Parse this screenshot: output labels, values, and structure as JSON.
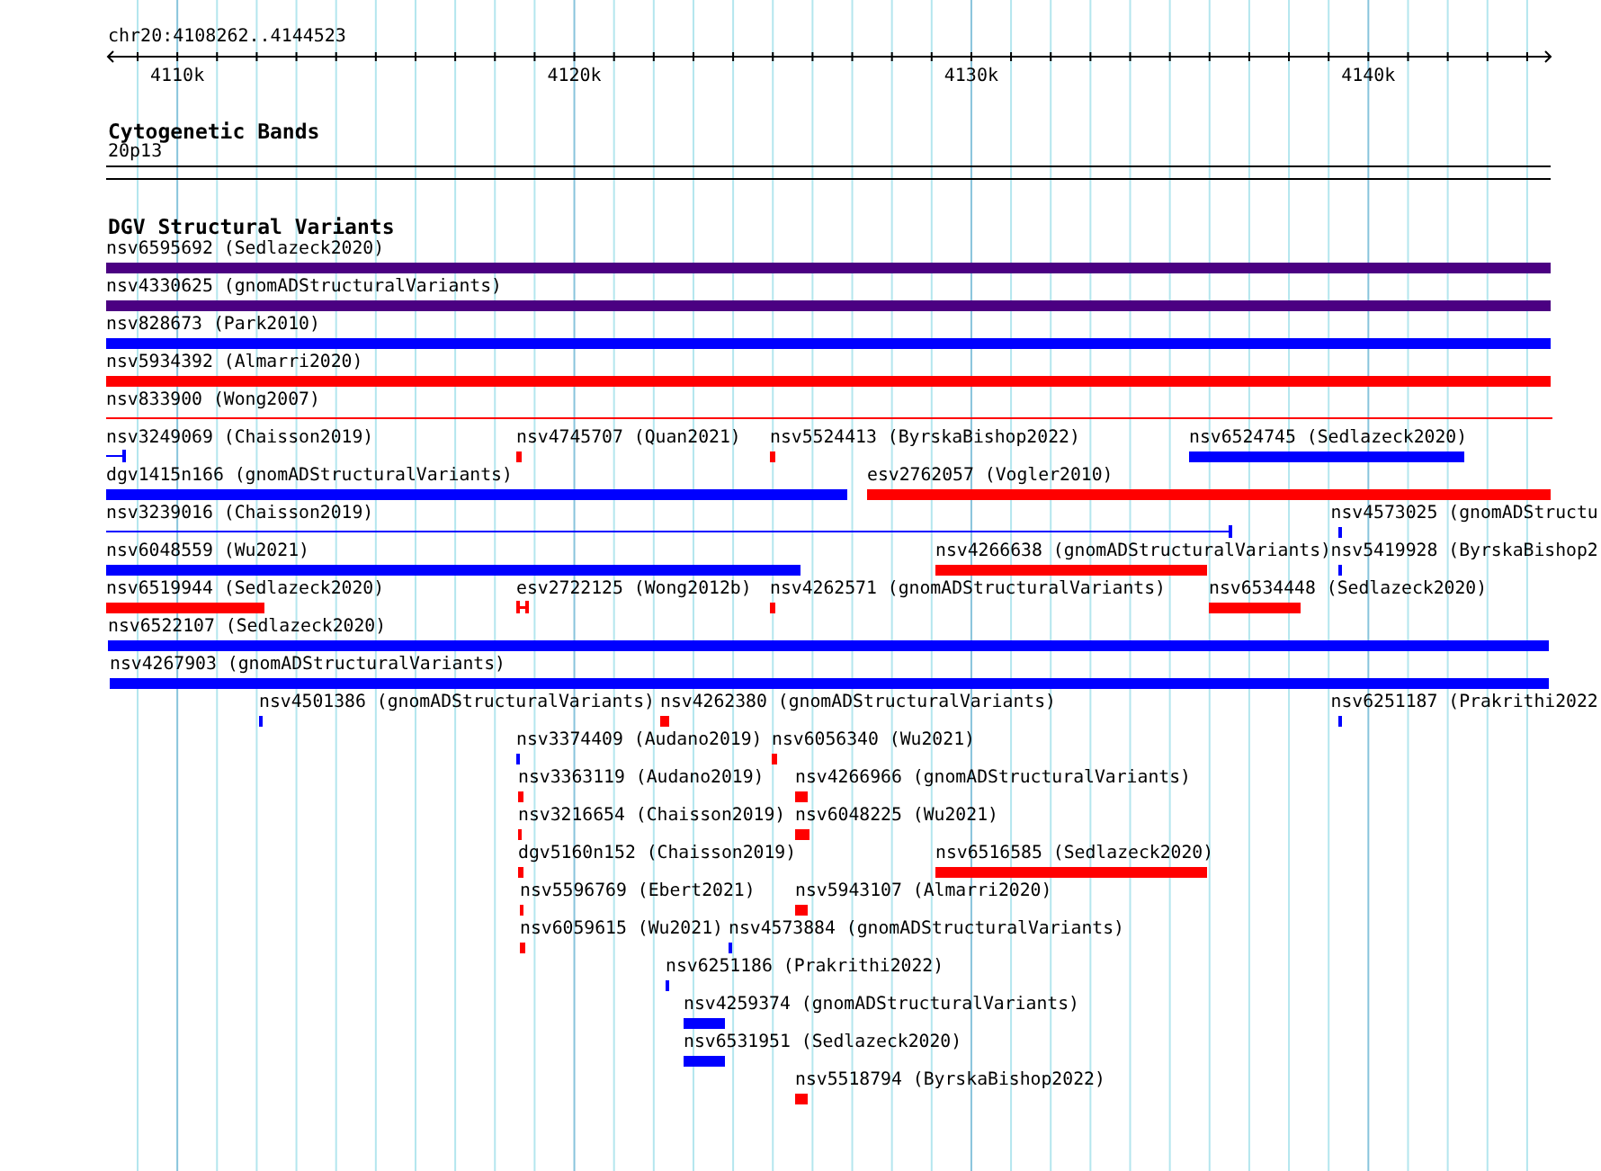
{
  "location": "chr20:4108262..4144523",
  "ruler": {
    "tick_labels": [
      "4110k",
      "4120k",
      "4130k",
      "4140k"
    ]
  },
  "cytogenetic_bands": {
    "title": "Cytogenetic Bands",
    "band": "20p13"
  },
  "dgv_track": {
    "title": "DGV Structural Variants",
    "rows": [
      {
        "features": [
          {
            "label": "nsv6595692 (Sedlazeck2020)",
            "color": "#4b0082",
            "kind": "bar"
          }
        ]
      },
      {
        "features": [
          {
            "label": "nsv4330625 (gnomADStructuralVariants)",
            "color": "#4b0082",
            "kind": "bar"
          }
        ]
      },
      {
        "features": [
          {
            "label": "nsv828673 (Park2010)",
            "color": "#0000ff",
            "kind": "bar"
          }
        ]
      },
      {
        "features": [
          {
            "label": "nsv5934392 (Almarri2020)",
            "color": "#ff0000",
            "kind": "bar"
          }
        ]
      },
      {
        "features": [
          {
            "label": "nsv833900 (Wong2007)",
            "color": "#ff0000",
            "kind": "line"
          }
        ]
      },
      {
        "features": [
          {
            "label": "nsv3249069 (Chaisson2019)",
            "color": "#0000ff",
            "kind": "line"
          },
          {
            "label": "nsv4745707 (Quan2021)",
            "color": "#ff0000",
            "kind": "bar"
          },
          {
            "label": "nsv5524413 (ByrskaBishop2022)",
            "color": "#ff0000",
            "kind": "bar"
          },
          {
            "label": "nsv6524745 (Sedlazeck2020)",
            "color": "#0000ff",
            "kind": "bar"
          }
        ]
      },
      {
        "features": [
          {
            "label": "dgv1415n166 (gnomADStructuralVariants)",
            "color": "#0000ff",
            "kind": "bar"
          },
          {
            "label": "esv2762057 (Vogler2010)",
            "color": "#ff0000",
            "kind": "bar"
          }
        ]
      },
      {
        "features": [
          {
            "label": "nsv3239016 (Chaisson2019)",
            "color": "#0000ff",
            "kind": "line"
          },
          {
            "label": "nsv4573025 (gnomADStructu",
            "color": "#0000ff",
            "kind": "bar"
          }
        ]
      },
      {
        "features": [
          {
            "label": "nsv6048559 (Wu2021)",
            "color": "#0000ff",
            "kind": "bar"
          },
          {
            "label": "nsv4266638 (gnomADStructuralVariants)",
            "color": "#ff0000",
            "kind": "bar"
          },
          {
            "label": "nsv5419928 (ByrskaBishop2",
            "color": "#0000ff",
            "kind": "bar"
          }
        ]
      },
      {
        "features": [
          {
            "label": "nsv6519944 (Sedlazeck2020)",
            "color": "#ff0000",
            "kind": "bar"
          },
          {
            "label": "esv2722125 (Wong2012b)",
            "color": "#ff0000",
            "kind": "span"
          },
          {
            "label": "nsv4262571 (gnomADStructuralVariants)",
            "color": "#ff0000",
            "kind": "bar"
          },
          {
            "label": "nsv6534448 (Sedlazeck2020)",
            "color": "#ff0000",
            "kind": "bar"
          }
        ]
      },
      {
        "features": [
          {
            "label": "nsv6522107 (Sedlazeck2020)",
            "color": "#0000ff",
            "kind": "bar"
          }
        ]
      },
      {
        "features": [
          {
            "label": "nsv4267903 (gnomADStructuralVariants)",
            "color": "#0000ff",
            "kind": "bar"
          }
        ]
      },
      {
        "features": [
          {
            "label": "nsv4501386 (gnomADStructuralVariants)",
            "color": "#0000ff",
            "kind": "bar"
          },
          {
            "label": "nsv4262380 (gnomADStructuralVariants)",
            "color": "#ff0000",
            "kind": "bar"
          },
          {
            "label": "nsv6251187 (Prakrithi2022",
            "color": "#0000ff",
            "kind": "bar"
          }
        ]
      },
      {
        "features": [
          {
            "label": "nsv3374409 (Audano2019)",
            "color": "#0000ff",
            "kind": "bar"
          },
          {
            "label": "nsv6056340 (Wu2021)",
            "color": "#ff0000",
            "kind": "bar"
          }
        ]
      },
      {
        "features": [
          {
            "label": "nsv3363119 (Audano2019)",
            "color": "#ff0000",
            "kind": "bar"
          },
          {
            "label": "nsv4266966 (gnomADStructuralVariants)",
            "color": "#ff0000",
            "kind": "bar"
          }
        ]
      },
      {
        "features": [
          {
            "label": "nsv3216654 (Chaisson2019)",
            "color": "#ff0000",
            "kind": "bar"
          },
          {
            "label": "nsv6048225 (Wu2021)",
            "color": "#ff0000",
            "kind": "bar"
          }
        ]
      },
      {
        "features": [
          {
            "label": "dgv5160n152 (Chaisson2019)",
            "color": "#ff0000",
            "kind": "bar"
          },
          {
            "label": "nsv6516585 (Sedlazeck2020)",
            "color": "#ff0000",
            "kind": "bar"
          }
        ]
      },
      {
        "features": [
          {
            "label": "nsv5596769 (Ebert2021)",
            "color": "#ff0000",
            "kind": "bar"
          },
          {
            "label": "nsv5943107 (Almarri2020)",
            "color": "#ff0000",
            "kind": "bar"
          }
        ]
      },
      {
        "features": [
          {
            "label": "nsv6059615 (Wu2021)",
            "color": "#ff0000",
            "kind": "bar"
          },
          {
            "label": "nsv4573884 (gnomADStructuralVariants)",
            "color": "#0000ff",
            "kind": "bar"
          }
        ]
      },
      {
        "features": [
          {
            "label": "nsv6251186 (Prakrithi2022)",
            "color": "#0000ff",
            "kind": "bar"
          }
        ]
      },
      {
        "features": [
          {
            "label": "nsv4259374 (gnomADStructuralVariants)",
            "color": "#0000ff",
            "kind": "bar"
          }
        ]
      },
      {
        "features": [
          {
            "label": "nsv6531951 (Sedlazeck2020)",
            "color": "#0000ff",
            "kind": "bar"
          }
        ]
      },
      {
        "features": [
          {
            "label": "nsv5518794 (ByrskaBishop2022)",
            "color": "#ff0000",
            "kind": "bar"
          }
        ]
      }
    ]
  }
}
